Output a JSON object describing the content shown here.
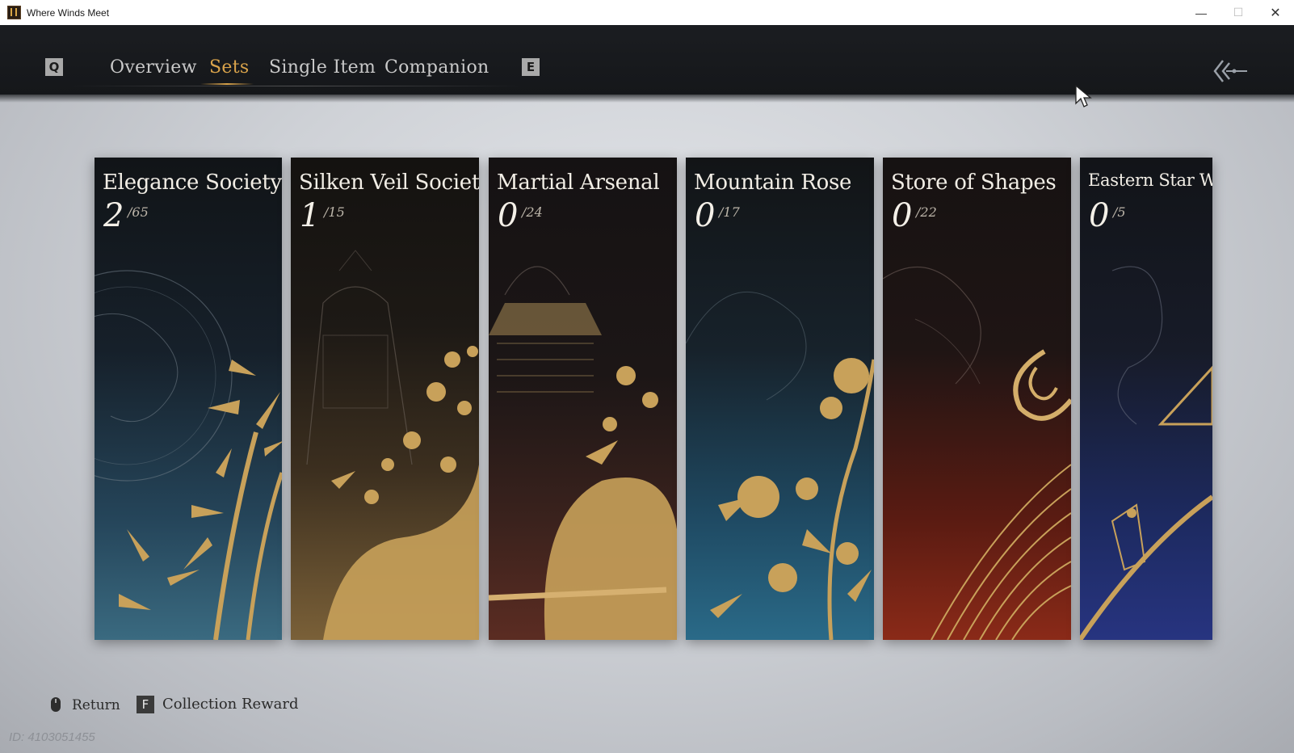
{
  "window": {
    "title": "Where Winds Meet",
    "min": "—",
    "max": "☐",
    "close": "✕"
  },
  "nav": {
    "key_left": "Q",
    "key_right": "E",
    "tabs": [
      "Overview",
      "Sets",
      "Single Item",
      "Companion"
    ],
    "active_tab": "Sets"
  },
  "cards": [
    {
      "title": "Elegance Society",
      "count": "2",
      "total": "/65",
      "theme": "#3a6a80"
    },
    {
      "title": "Silken Veil Society",
      "count": "1",
      "total": "/15",
      "theme": "#7a6038"
    },
    {
      "title": "Martial Arsenal",
      "count": "0",
      "total": "/24",
      "theme": "#5b2c22"
    },
    {
      "title": "Mountain Rose",
      "count": "0",
      "total": "/17",
      "theme": "#2a6a88"
    },
    {
      "title": "Store of Shapes",
      "count": "0",
      "total": "/22",
      "theme": "#8a2a18"
    },
    {
      "title": "Eastern Star We",
      "count": "0",
      "total": "/5",
      "theme": "#273480"
    }
  ],
  "footer": {
    "return_label": "Return",
    "reward_key": "F",
    "reward_label": "Collection Reward",
    "player_id": "ID: 4103051455"
  },
  "colors": {
    "accent": "#d9a34b",
    "gold": "#c8a15a"
  }
}
